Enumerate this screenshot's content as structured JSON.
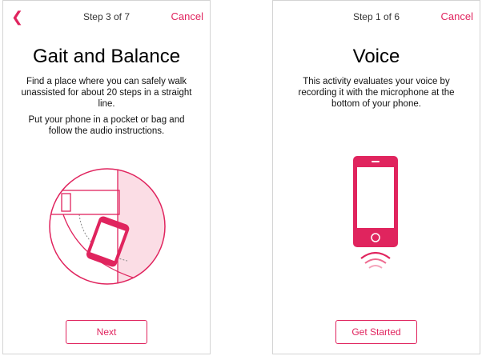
{
  "left_screen": {
    "back_icon": "chevron-left-icon",
    "step_label": "Step 3 of 7",
    "cancel_label": "Cancel",
    "title": "Gait and Balance",
    "paragraph1": "Find a place where you can safely walk unassisted for about 20 steps in a straight line.",
    "paragraph2": "Put your phone in a pocket or bag and follow the audio instructions.",
    "illustration_icon": "gait-pocket-phone-illustration",
    "button_label": "Next"
  },
  "right_screen": {
    "step_label": "Step 1 of 6",
    "cancel_label": "Cancel",
    "title": "Voice",
    "paragraph1": "This activity evaluates your voice by recording it with the microphone at the bottom of your phone.",
    "illustration_icon": "phone-microphone-illustration",
    "button_label": "Get Started"
  },
  "colors": {
    "accent": "#e0245e",
    "accent_light": "#fbdde5",
    "border": "#d4d4d4"
  }
}
